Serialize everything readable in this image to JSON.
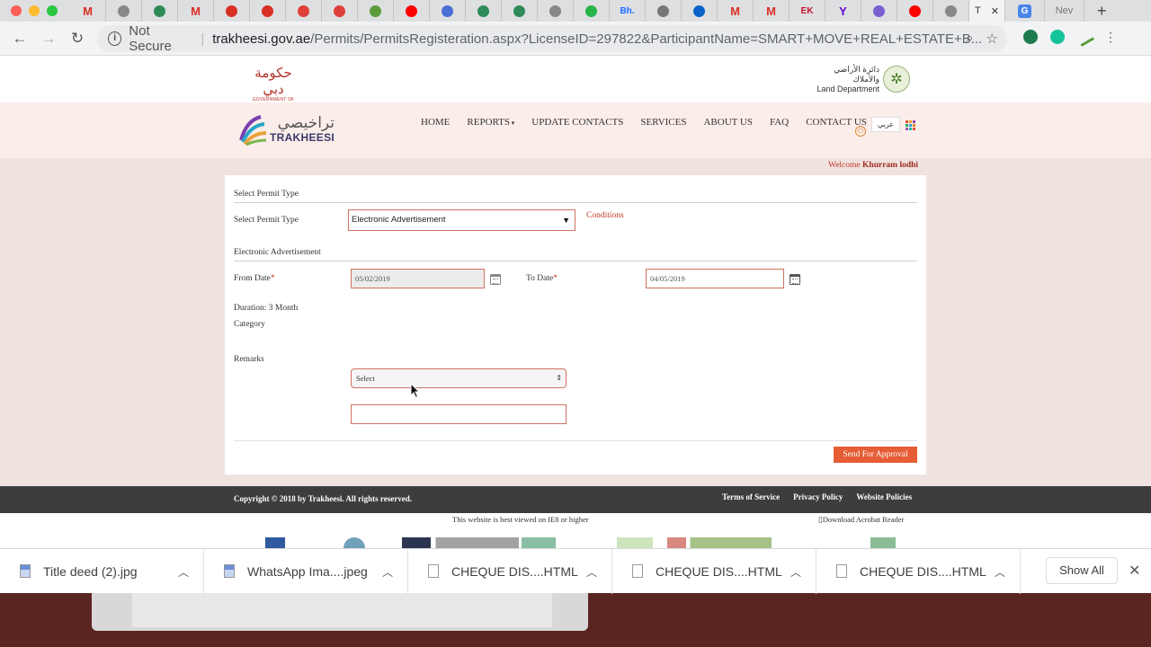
{
  "browser": {
    "tabs": [
      {
        "icon": "gmail-icon",
        "glyph": "M",
        "color": "#d93025"
      },
      {
        "icon": "document-icon",
        "glyph": "",
        "color": "#888888"
      },
      {
        "icon": "green-circle-icon",
        "glyph": "",
        "color": "#2e8b57"
      },
      {
        "icon": "gmail-icon",
        "glyph": "M",
        "color": "#d93025"
      },
      {
        "icon": "flame-icon",
        "glyph": "",
        "color": "#d93025"
      },
      {
        "icon": "flame-icon",
        "glyph": "",
        "color": "#d93025"
      },
      {
        "icon": "red-shape-icon",
        "glyph": "",
        "color": "#e0403a"
      },
      {
        "icon": "red-shape-icon",
        "glyph": "",
        "color": "#e0403a"
      },
      {
        "icon": "pick-icon",
        "glyph": "",
        "color": "#5a9c3a"
      },
      {
        "icon": "youtube-icon",
        "glyph": "",
        "color": "#ff0000"
      },
      {
        "icon": "location-icon",
        "glyph": "",
        "color": "#4a6fd6"
      },
      {
        "icon": "green-circle-icon",
        "glyph": "",
        "color": "#2e8b57"
      },
      {
        "icon": "green-circle-icon",
        "glyph": "",
        "color": "#2e8b57"
      },
      {
        "icon": "document-icon",
        "glyph": "",
        "color": "#888888"
      },
      {
        "icon": "chat-icon",
        "glyph": "",
        "color": "#25b34a"
      },
      {
        "icon": "behance-icon",
        "glyph": "Bh.",
        "color": "#1769ff"
      },
      {
        "icon": "apple-icon",
        "glyph": "",
        "color": "#777777"
      },
      {
        "icon": "outlook-icon",
        "glyph": "",
        "color": "#0a64c8"
      },
      {
        "icon": "gmail-icon",
        "glyph": "M",
        "color": "#d93025"
      },
      {
        "icon": "gmail-icon",
        "glyph": "M",
        "color": "#d93025"
      },
      {
        "icon": "ek-icon",
        "glyph": "EK",
        "color": "#c4122f"
      },
      {
        "icon": "yahoo-icon",
        "glyph": "Y",
        "color": "#5f01d1"
      },
      {
        "icon": "flower-icon",
        "glyph": "",
        "color": "#7a5fd0"
      },
      {
        "icon": "youtube-icon",
        "glyph": "",
        "color": "#ff0000"
      },
      {
        "icon": "document-icon",
        "glyph": "",
        "color": "#888888"
      }
    ],
    "active_tab_label": "T",
    "last_tabs": [
      {
        "icon": "translate-icon",
        "label": ""
      },
      {
        "icon": "new-tab-icon",
        "label": "Nev"
      }
    ],
    "security_label": "Not Secure",
    "url_host": "trakheesi.gov.ae",
    "url_path": "/Permits/PermitsRegisteration.aspx?LicenseID=297822&ParticipantName=SMART+MOVE+REAL+ESTATE+B..."
  },
  "header": {
    "gov_ar": "حكومة دبي",
    "gov_en": "GOVERNMENT OF DUBAI",
    "land_ar": "دائرة الأراضي والأملاك",
    "land_en": "Land Department"
  },
  "nav": {
    "logo_ar": "تراخيصي",
    "logo_en": "TRAKHEESI",
    "items": [
      "HOME",
      "REPORTS",
      "UPDATE CONTACTS",
      "SERVICES",
      "ABOUT US",
      "FAQ",
      "CONTACT US"
    ],
    "lang_label": "عربي"
  },
  "welcome": {
    "prefix": "Welcome",
    "user": "Khurram lodhi"
  },
  "form": {
    "section1_title": "Select Permit Type",
    "permit_label": "Select Permit Type",
    "permit_value": "Electronic Advertisement",
    "conditions_link": "Conditions",
    "section2_title": "Electronic Advertisement",
    "from_label": "From Date",
    "from_value": "05/02/2019",
    "to_label": "To Date",
    "to_value": "04/05/2019",
    "duration": "Duration: 3 Month",
    "category_label": "Category",
    "category_value": "Select",
    "remarks_label": "Remarks",
    "remarks_value": "",
    "submit_label": "Send For Approval",
    "required_mark": "*"
  },
  "footer": {
    "copyright": "Copyright © 2018 by Trakheesi. All rights reserved.",
    "links": [
      "Terms of Service",
      "Privacy Policy",
      "Website Policies"
    ],
    "best_viewed": "This website is best viewed on IE8 or higher",
    "acrobat": "Download Acrobat Reader"
  },
  "downloads": {
    "items": [
      {
        "name": "Title deed (2).jpg",
        "type": "image"
      },
      {
        "name": "WhatsApp Ima....jpeg",
        "type": "image"
      },
      {
        "name": "CHEQUE DIS....HTML",
        "type": "file"
      },
      {
        "name": "CHEQUE DIS....HTML",
        "type": "file"
      },
      {
        "name": "CHEQUE DIS....HTML",
        "type": "file"
      }
    ],
    "show_all": "Show All"
  }
}
